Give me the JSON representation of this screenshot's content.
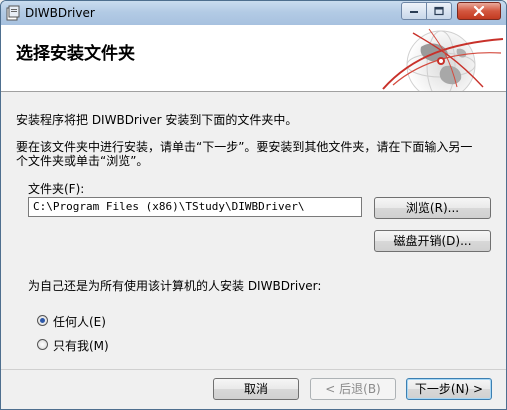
{
  "window": {
    "title": "DIWBDriver",
    "icon": "installer-icon",
    "controls": [
      "minimize-icon",
      "maximize-icon",
      "close-icon"
    ]
  },
  "header": {
    "title": "选择安装文件夹",
    "graphic": "globe-icon"
  },
  "body": {
    "line1": "安装程序将把 DIWBDriver 安装到下面的文件夹中。",
    "line2": "要在该文件夹中进行安装，请单击“下一步”。要安装到其他文件夹，请在下面输入另一",
    "line3": "个文件夹或单击“浏览”。",
    "folder_label": "文件夹(F):",
    "folder_value": "C:\\Program Files (x86)\\TStudy\\DIWBDriver\\",
    "browse_label": "浏览(R)...",
    "disk_cost_label": "磁盘开销(D)...",
    "install_for_label": "为自己还是为所有使用该计算机的人安装 DIWBDriver:",
    "options": [
      {
        "label": "任何人(E)",
        "checked": true
      },
      {
        "label": "只有我(M)",
        "checked": false
      }
    ]
  },
  "footer": {
    "cancel_label": "取消",
    "back_label": "< 后退(B)",
    "next_label": "下一步(N) >"
  },
  "colors": {
    "title_bar": "#b3cbe5",
    "close_button": "#c23a21",
    "radio_dot": "#2d58a8"
  }
}
